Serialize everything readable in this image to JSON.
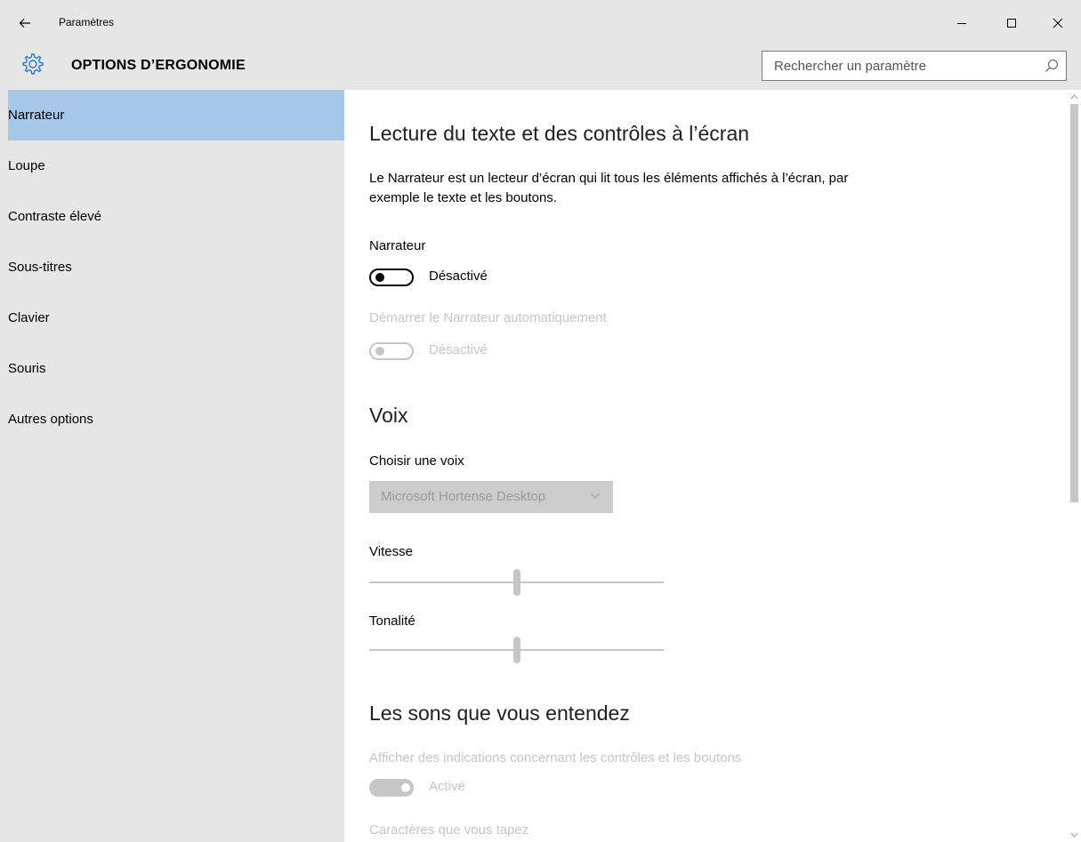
{
  "window": {
    "title": "Paramètres",
    "back_icon": "back-arrow-icon",
    "minimize_icon": "minimize-icon",
    "maximize_icon": "maximize-icon",
    "close_icon": "close-icon"
  },
  "header": {
    "title": "OPTIONS D’ERGONOMIE",
    "icon": "gear-icon",
    "accent_color": "#2b7bd3",
    "search": {
      "value": "",
      "placeholder": "Rechercher un paramètre",
      "icon": "search-icon"
    }
  },
  "sidebar": {
    "background": "#e6e6e6",
    "selected_background": "#a6c8e8",
    "items": [
      {
        "label": "Narrateur",
        "selected": true
      },
      {
        "label": "Loupe",
        "selected": false
      },
      {
        "label": "Contraste élevé",
        "selected": false
      },
      {
        "label": "Sous-titres",
        "selected": false
      },
      {
        "label": "Clavier",
        "selected": false
      },
      {
        "label": "Souris",
        "selected": false
      },
      {
        "label": "Autres options",
        "selected": false
      }
    ]
  },
  "main": {
    "section1": {
      "heading": "Lecture du texte et des contrôles à l’écran",
      "description": "Le Narrateur est un lecteur d’écran qui lit tous les éléments affichés à l’écran, par exemple le texte et les boutons.",
      "narrator": {
        "label": "Narrateur",
        "state_text": "Désactivé",
        "on": false,
        "enabled": true
      },
      "autostart": {
        "label": "Démarrer le Narrateur automatiquement",
        "state_text": "Désactivé",
        "on": false,
        "enabled": false
      }
    },
    "voice": {
      "heading": "Voix",
      "choose_label": "Choisir une voix",
      "selected_voice": "Microsoft Hortense Desktop",
      "speed": {
        "label": "Vitesse",
        "value_fraction": 0.5
      },
      "pitch": {
        "label": "Tonalité",
        "value_fraction": 0.5
      }
    },
    "sounds": {
      "heading": "Les sons que vous entendez",
      "hints": {
        "label": "Afficher des indications concernant les contrôles et les boutons",
        "state_text": "Activé",
        "on": true,
        "enabled": false
      },
      "typed_chars_label": "Caractères que vous tapez"
    }
  },
  "scrollbar": {
    "position_fraction": 0.0,
    "visible_fraction": 0.55
  }
}
